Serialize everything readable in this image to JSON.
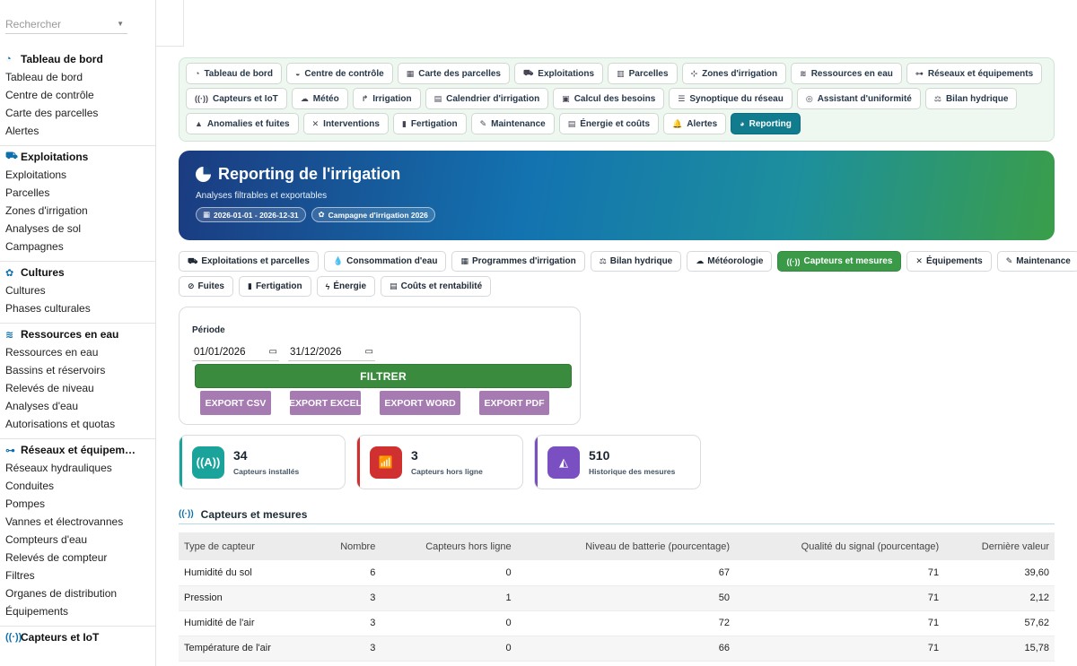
{
  "sidebar": {
    "search_placeholder": "Rechercher",
    "sections": [
      {
        "title": "Tableau de bord",
        "icon": "dashboard-icon",
        "glyph": "◔",
        "items": [
          "Tableau de bord",
          "Centre de contrôle",
          "Carte des parcelles",
          "Alertes"
        ]
      },
      {
        "title": "Exploitations",
        "icon": "tractor-icon",
        "glyph": "⛟",
        "items": [
          "Exploitations",
          "Parcelles",
          "Zones d'irrigation",
          "Analyses de sol",
          "Campagnes"
        ]
      },
      {
        "title": "Cultures",
        "icon": "seedling-icon",
        "glyph": "✿",
        "items": [
          "Cultures",
          "Phases culturales"
        ]
      },
      {
        "title": "Ressources en eau",
        "icon": "water-icon",
        "glyph": "≋",
        "items": [
          "Ressources en eau",
          "Bassins et réservoirs",
          "Relevés de niveau",
          "Analyses d'eau",
          "Autorisations et quotas"
        ]
      },
      {
        "title": "Réseaux et équipem…",
        "icon": "network-icon",
        "glyph": "⊶",
        "items": [
          "Réseaux hydrauliques",
          "Conduites",
          "Pompes",
          "Vannes et électrovannes",
          "Compteurs d'eau",
          "Relevés de compteur",
          "Filtres",
          "Organes de distribution",
          "Équipements"
        ]
      },
      {
        "title": "Capteurs et IoT",
        "icon": "sensor-icon",
        "glyph": "((·))",
        "items": []
      }
    ]
  },
  "nav": {
    "rows": [
      [
        {
          "label": "Tableau de bord",
          "icon": "dashboard-icon",
          "glyph": "◔"
        },
        {
          "label": "Centre de contrôle",
          "icon": "gauge-icon",
          "glyph": "◒"
        },
        {
          "label": "Carte des parcelles",
          "icon": "map-icon",
          "glyph": "▦"
        },
        {
          "label": "Exploitations",
          "icon": "tractor-icon",
          "glyph": "⛟"
        },
        {
          "label": "Parcelles",
          "icon": "map-fold-icon",
          "glyph": "▥"
        },
        {
          "label": "Zones d'irrigation",
          "icon": "sitemap-icon",
          "glyph": "⊹"
        },
        {
          "label": "Ressources en eau",
          "icon": "water-icon",
          "glyph": "≋"
        },
        {
          "label": "Réseaux et équipements",
          "icon": "network-icon",
          "glyph": "⊶"
        }
      ],
      [
        {
          "label": "Capteurs et IoT",
          "icon": "sensor-icon",
          "glyph": "((·))"
        },
        {
          "label": "Météo",
          "icon": "cloud-sun-icon",
          "glyph": "☁"
        },
        {
          "label": "Irrigation",
          "icon": "faucet-icon",
          "glyph": "↱"
        },
        {
          "label": "Calendrier d'irrigation",
          "icon": "calendar-icon",
          "glyph": "▤"
        },
        {
          "label": "Calcul des besoins",
          "icon": "calculator-icon",
          "glyph": "▣"
        },
        {
          "label": "Synoptique du réseau",
          "icon": "list-icon",
          "glyph": "☰"
        },
        {
          "label": "Assistant d'uniformité",
          "icon": "target-icon",
          "glyph": "◎"
        },
        {
          "label": "Bilan hydrique",
          "icon": "balance-icon",
          "glyph": "⚖"
        }
      ],
      [
        {
          "label": "Anomalies et fuites",
          "icon": "warning-icon",
          "glyph": "▲"
        },
        {
          "label": "Interventions",
          "icon": "tools-icon",
          "glyph": "✕"
        },
        {
          "label": "Fertigation",
          "icon": "flask-icon",
          "glyph": "▮"
        },
        {
          "label": "Maintenance",
          "icon": "wrench-icon",
          "glyph": "✎"
        },
        {
          "label": "Énergie et coûts",
          "icon": "coins-icon",
          "glyph": "▤"
        },
        {
          "label": "Alertes",
          "icon": "bell-icon",
          "glyph": "🔔"
        },
        {
          "label": "Reporting",
          "icon": "chart-pie-icon",
          "glyph": "◕",
          "active": true
        }
      ]
    ]
  },
  "hero": {
    "title": "Reporting de l'irrigation",
    "subtitle": "Analyses filtrables et exportables",
    "tags": [
      {
        "label": "2026-01-01 - 2026-12-31",
        "icon": "calendar-icon",
        "glyph": "▦"
      },
      {
        "label": "Campagne d'irrigation 2026",
        "icon": "seedling-icon",
        "glyph": "✿"
      }
    ]
  },
  "subtabs": {
    "rows": [
      [
        {
          "label": "Exploitations et parcelles",
          "icon": "tractor-icon",
          "glyph": "⛟"
        },
        {
          "label": "Consommation d'eau",
          "icon": "droplet-icon",
          "glyph": "💧"
        },
        {
          "label": "Programmes d'irrigation",
          "icon": "calendar-check-icon",
          "glyph": "▦"
        },
        {
          "label": "Bilan hydrique",
          "icon": "balance-icon",
          "glyph": "⚖"
        },
        {
          "label": "Météorologie",
          "icon": "cloud-sun-icon",
          "glyph": "☁"
        },
        {
          "label": "Capteurs et mesures",
          "icon": "sensor-icon",
          "glyph": "((·))",
          "active": true
        },
        {
          "label": "Équipements",
          "icon": "tools-icon",
          "glyph": "✕"
        },
        {
          "label": "Maintenance",
          "icon": "wrench-icon",
          "glyph": "✎"
        }
      ],
      [
        {
          "label": "Fuites",
          "icon": "faucet-off-icon",
          "glyph": "⊘"
        },
        {
          "label": "Fertigation",
          "icon": "flask-icon",
          "glyph": "▮"
        },
        {
          "label": "Énergie",
          "icon": "bolt-icon",
          "glyph": "ϟ"
        },
        {
          "label": "Coûts et rentabilité",
          "icon": "coins-icon",
          "glyph": "▤"
        }
      ]
    ]
  },
  "filter": {
    "period_label": "Période",
    "date_from": "01/01/2026",
    "date_to": "31/12/2026",
    "filter_label": "FILTRER",
    "exports": [
      "EXPORT CSV",
      "EXPORT EXCEL",
      "EXPORT WORD",
      "EXPORT PDF"
    ]
  },
  "kpis": [
    {
      "value": "34",
      "label": "Capteurs installés",
      "color": "#1aa39a",
      "bar": "#1aa39a",
      "icon": "sensor-icon",
      "glyph": "((A))"
    },
    {
      "value": "3",
      "label": "Capteurs hors ligne",
      "color": "#d0302f",
      "bar": "#d0302f",
      "icon": "wifi-off-icon",
      "glyph": "📶"
    },
    {
      "value": "510",
      "label": "Historique des mesures",
      "color": "#7a4fc1",
      "bar": "#7a4fc1",
      "icon": "chart-area-icon",
      "glyph": "◭"
    }
  ],
  "table_section": {
    "title": "Capteurs et mesures",
    "icon": "sensor-icon",
    "glyph": "((·))"
  },
  "table": {
    "headers": [
      "Type de capteur",
      "Nombre",
      "Capteurs hors ligne",
      "Niveau de batterie (pourcentage)",
      "Qualité du signal (pourcentage)",
      "Dernière valeur"
    ],
    "rows": [
      [
        "Humidité du sol",
        "6",
        "0",
        "67",
        "71",
        "39,60"
      ],
      [
        "Pression",
        "3",
        "1",
        "50",
        "71",
        "2,12"
      ],
      [
        "Humidité de l'air",
        "3",
        "0",
        "72",
        "71",
        "57,62"
      ],
      [
        "Température de l'air",
        "3",
        "0",
        "66",
        "71",
        "15,78"
      ]
    ]
  },
  "colors": {
    "accent_green": "#3a8b3e",
    "reporting_active": "#127c8f",
    "export_purple": "#a57bb2"
  }
}
